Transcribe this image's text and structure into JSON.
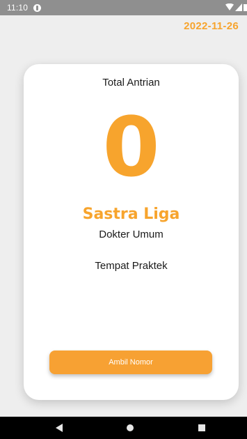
{
  "status_bar": {
    "time": "11:10",
    "app_icon": "notification-app-icon",
    "icons": [
      "wifi-icon",
      "signal-icon",
      "battery-icon"
    ]
  },
  "header": {
    "date": "2022-11-26"
  },
  "card": {
    "title": "Total Antrian",
    "queue_number": "0",
    "doctor_name": "Sastra Liga",
    "specialty": "Dokter Umum",
    "practice_place": "Tempat Praktek",
    "button_label": "Ambil Nomor"
  },
  "nav_bar": {
    "icons": [
      "back-icon",
      "home-icon",
      "recents-icon"
    ]
  },
  "colors": {
    "accent": "#f7a42d",
    "status_bar": "#8f8f8f",
    "background": "#eeeeee",
    "card": "#ffffff"
  }
}
